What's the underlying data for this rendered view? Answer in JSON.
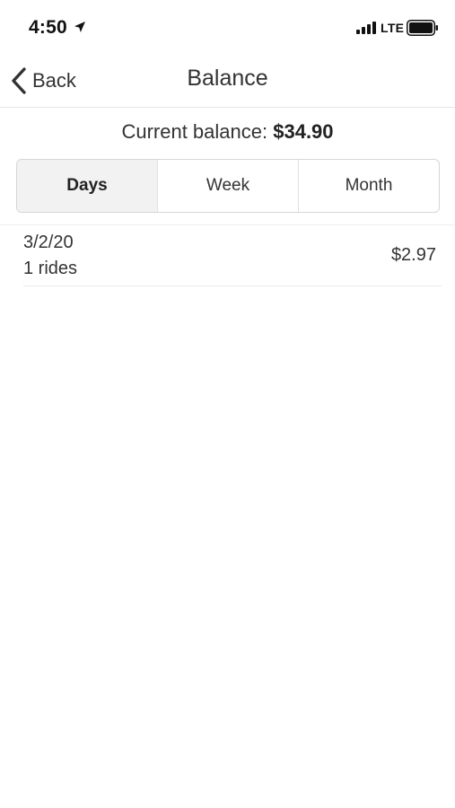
{
  "status_bar": {
    "time": "4:50",
    "network": "LTE",
    "icons": [
      "location-arrow-icon",
      "cellular-signal-icon",
      "battery-icon"
    ]
  },
  "nav": {
    "back_label": "Back",
    "title": "Balance"
  },
  "balance": {
    "label": "Current balance:",
    "value": "$34.90"
  },
  "tabs": [
    {
      "label": "Days",
      "selected": true
    },
    {
      "label": "Week",
      "selected": false
    },
    {
      "label": "Month",
      "selected": false
    }
  ],
  "entries": [
    {
      "date": "3/2/20",
      "rides": "1 rides",
      "amount": "$2.97"
    }
  ],
  "colors": {
    "text": "#333333",
    "active_tab_bg": "#f2f2f2",
    "divider": "#e6e6e6"
  }
}
